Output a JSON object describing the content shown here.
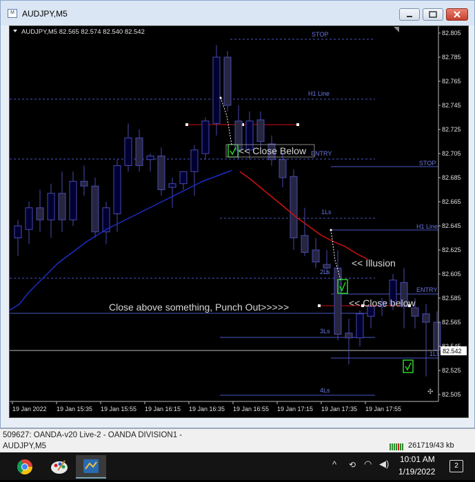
{
  "window": {
    "title": "AUDJPY,M5",
    "icon_glyph": "M"
  },
  "chart": {
    "header": "AUDJPY,M5  82.565 82.574 82.540 82.542",
    "current_price": "82.542",
    "y_min": 82.5,
    "y_max": 82.81,
    "price_labels": [
      "82.805",
      "82.785",
      "82.765",
      "82.745",
      "82.725",
      "82.705",
      "82.685",
      "82.665",
      "82.645",
      "82.625",
      "82.605",
      "82.585",
      "82.565",
      "82.545",
      "82.525",
      "82.505"
    ],
    "time_labels": [
      "19 Jan 2022",
      "19 Jan 15:35",
      "19 Jan 15:55",
      "19 Jan 16:15",
      "19 Jan 16:35",
      "19 Jan 16:55",
      "19 Jan 17:15",
      "19 Jan 17:35",
      "19 Jan 17:55"
    ],
    "candles": [
      {
        "o": 82.635,
        "h": 82.65,
        "l": 82.62,
        "c": 82.645
      },
      {
        "o": 82.642,
        "h": 82.665,
        "l": 82.63,
        "c": 82.66
      },
      {
        "o": 82.66,
        "h": 82.675,
        "l": 82.64,
        "c": 82.65
      },
      {
        "o": 82.65,
        "h": 82.68,
        "l": 82.635,
        "c": 82.672
      },
      {
        "o": 82.672,
        "h": 82.69,
        "l": 82.64,
        "c": 82.65
      },
      {
        "o": 82.65,
        "h": 82.69,
        "l": 82.645,
        "c": 82.682
      },
      {
        "o": 82.682,
        "h": 82.695,
        "l": 82.67,
        "c": 82.678
      },
      {
        "o": 82.678,
        "h": 82.685,
        "l": 82.635,
        "c": 82.64
      },
      {
        "o": 82.64,
        "h": 82.665,
        "l": 82.63,
        "c": 82.66
      },
      {
        "o": 82.655,
        "h": 82.7,
        "l": 82.64,
        "c": 82.695
      },
      {
        "o": 82.695,
        "h": 82.73,
        "l": 82.69,
        "c": 82.718
      },
      {
        "o": 82.718,
        "h": 82.725,
        "l": 82.69,
        "c": 82.695
      },
      {
        "o": 82.7,
        "h": 82.705,
        "l": 82.69,
        "c": 82.703
      },
      {
        "o": 82.703,
        "h": 82.71,
        "l": 82.67,
        "c": 82.675
      },
      {
        "o": 82.677,
        "h": 82.685,
        "l": 82.66,
        "c": 82.68
      },
      {
        "o": 82.68,
        "h": 82.69,
        "l": 82.675,
        "c": 82.69
      },
      {
        "o": 82.69,
        "h": 82.712,
        "l": 82.67,
        "c": 82.708
      },
      {
        "o": 82.705,
        "h": 82.735,
        "l": 82.7,
        "c": 82.732
      },
      {
        "o": 82.73,
        "h": 82.795,
        "l": 82.72,
        "c": 82.785
      },
      {
        "o": 82.785,
        "h": 82.79,
        "l": 82.74,
        "c": 82.745
      },
      {
        "o": 82.732,
        "h": 82.745,
        "l": 82.7,
        "c": 82.708
      },
      {
        "o": 82.708,
        "h": 82.74,
        "l": 82.7,
        "c": 82.732
      },
      {
        "o": 82.733,
        "h": 82.74,
        "l": 82.705,
        "c": 82.715
      },
      {
        "o": 82.713,
        "h": 82.72,
        "l": 82.695,
        "c": 82.7
      },
      {
        "o": 82.7,
        "h": 82.706,
        "l": 82.677,
        "c": 82.685
      },
      {
        "o": 82.686,
        "h": 82.692,
        "l": 82.625,
        "c": 82.635
      },
      {
        "o": 82.637,
        "h": 82.66,
        "l": 82.62,
        "c": 82.623
      },
      {
        "o": 82.625,
        "h": 82.635,
        "l": 82.61,
        "c": 82.615
      },
      {
        "o": 82.613,
        "h": 82.625,
        "l": 82.605,
        "c": 82.61
      },
      {
        "o": 82.61,
        "h": 82.625,
        "l": 82.55,
        "c": 82.555
      },
      {
        "o": 82.556,
        "h": 82.568,
        "l": 82.53,
        "c": 82.552
      },
      {
        "o": 82.552,
        "h": 82.575,
        "l": 82.545,
        "c": 82.572
      },
      {
        "o": 82.57,
        "h": 82.58,
        "l": 82.56,
        "c": 82.578
      },
      {
        "o": 82.578,
        "h": 82.585,
        "l": 82.57,
        "c": 82.582
      },
      {
        "o": 82.58,
        "h": 82.605,
        "l": 82.575,
        "c": 82.6
      },
      {
        "o": 82.598,
        "h": 82.61,
        "l": 82.56,
        "c": 82.578
      },
      {
        "o": 82.577,
        "h": 82.585,
        "l": 82.56,
        "c": 82.57
      },
      {
        "o": 82.572,
        "h": 82.58,
        "l": 82.52,
        "c": 82.565
      },
      {
        "o": 82.565,
        "h": 82.574,
        "l": 82.54,
        "c": 82.542
      }
    ],
    "ma_blue": [
      82.575,
      82.58,
      82.59,
      82.598,
      82.606,
      82.614,
      82.62,
      82.626,
      82.632,
      82.637,
      82.642,
      82.646,
      82.65,
      82.654,
      82.658,
      82.662,
      82.666,
      82.67,
      82.674,
      82.678,
      82.682,
      82.685,
      82.688,
      82.691
    ],
    "ma_red": [
      82.69,
      82.683,
      82.675,
      82.667,
      82.659,
      82.651,
      82.644,
      82.637,
      82.632,
      82.628,
      82.622,
      82.617
    ],
    "labels": {
      "stop_left": "STOP",
      "h1_left": "H1 Line",
      "entry_left": "ENTRY",
      "ls1_left": "1Ls",
      "ls2_left": "2Ls",
      "ls3_left": "3Ls",
      "ls4_left": "4Ls",
      "stop_right": "STOP",
      "h1_right": "H1 Line",
      "entry_right": "ENTRY",
      "ls1_right": "1Ls",
      "note_close_below_1": "<< Close Below",
      "note_illusion": "<< Illusion",
      "note_close_below_2": "<< Close below",
      "note_punch_out": "Close above something, Punch  Out>>>>>"
    },
    "colors": {
      "bull_body": "#000033",
      "bear_body": "#262640",
      "candle_outline": "#4a4ab0",
      "ma_blue": "#1a2ec8",
      "ma_red": "#d01010",
      "level_line": "#4a58c8",
      "annotation_text": "#d8d8d8",
      "signal_box": "#2ad52a"
    }
  },
  "status": {
    "account_line_1": "509627: OANDA-v20 Live-2 - OANDA DIVISION1 -",
    "account_line_2": "AUDJPY,M5",
    "traffic": "261719/43 kb"
  },
  "taskbar": {
    "time": "10:01 AM",
    "date": "1/19/2022",
    "notifications": "2",
    "chevron_glyph": "^",
    "sync_glyph": "⟲",
    "wifi_glyph": "◠",
    "volume_glyph": "◀)"
  }
}
